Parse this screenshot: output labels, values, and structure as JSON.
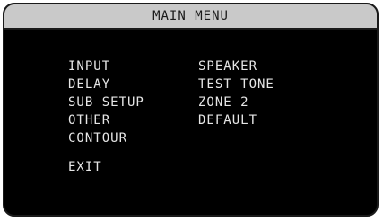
{
  "title": "MAIN MENU",
  "left_column": [
    "INPUT",
    "DELAY",
    "SUB SETUP",
    "OTHER",
    "CONTOUR"
  ],
  "right_column": [
    "SPEAKER",
    "TEST TONE",
    "ZONE 2",
    "DEFAULT"
  ],
  "exit_label": "EXIT",
  "colors": {
    "title_bar": "#c9c9c9",
    "screen": "#000000",
    "text": "#e6e6e6"
  }
}
